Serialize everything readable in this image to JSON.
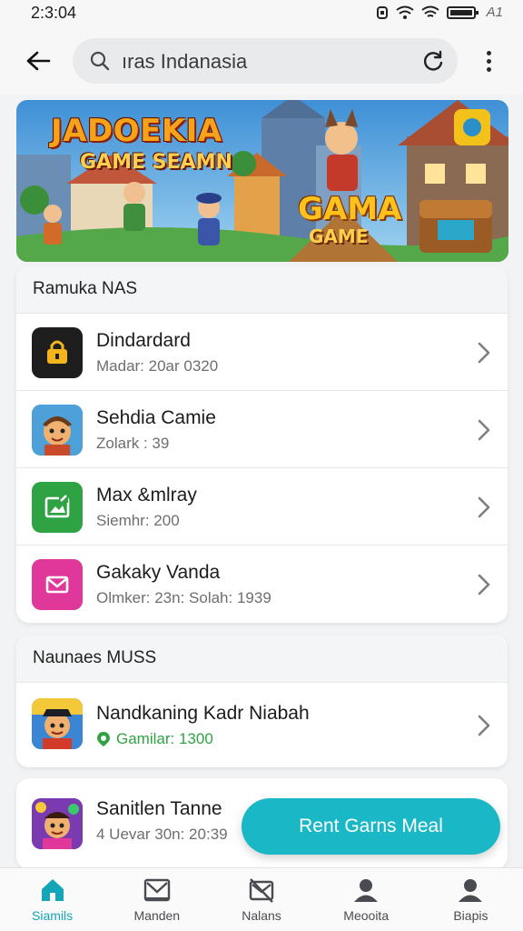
{
  "status_bar": {
    "time": "2:3:04",
    "battery_text": "A1"
  },
  "search": {
    "query": "ıras Indanasia"
  },
  "banner": {
    "title": "JADOEKIA",
    "subtitle": "GAME SEAMN",
    "badge_title": "GAMA",
    "badge_sub": "GAME"
  },
  "section1": {
    "header": "Ramuka NAS",
    "items": [
      {
        "title": "Dindardard",
        "subtitle": "Madar: 20ar 0320",
        "icon": "lock-icon"
      },
      {
        "title": "Sehdia Camie",
        "subtitle": "Zolark : 39",
        "icon": "game-avatar-icon"
      },
      {
        "title": "Max &mlray",
        "subtitle": "Siemhr: 200",
        "icon": "image-icon"
      },
      {
        "title": "Gakaky Vanda",
        "subtitle": "Olmker: 23n:  Solah: 1939",
        "icon": "mail-icon"
      }
    ]
  },
  "section2": {
    "header": "Naunaes MUSS",
    "items": [
      {
        "title": "Nandkaning Kadr Niabah",
        "subtitle": "Gamilar: 1300",
        "icon": "character-icon"
      }
    ]
  },
  "section3": {
    "items": [
      {
        "title": "Sanitlen Tanne",
        "subtitle": "4 Uevar 30n: 20:39",
        "icon": "character-icon"
      }
    ]
  },
  "fab": {
    "label": "Rent Garns Meal"
  },
  "bottom_nav": [
    {
      "label": "Siamils",
      "icon": "home-icon",
      "active": true
    },
    {
      "label": "Manden",
      "icon": "mail-icon",
      "active": false
    },
    {
      "label": "Nalans",
      "icon": "crossed-mail-icon",
      "active": false
    },
    {
      "label": "Meooita",
      "icon": "user-icon",
      "active": false
    },
    {
      "label": "Biapis",
      "icon": "profile-icon",
      "active": false
    }
  ],
  "colors": {
    "accent": "#1ab7c7",
    "active_nav": "#12a6b8",
    "background": "#f2f3f5"
  }
}
